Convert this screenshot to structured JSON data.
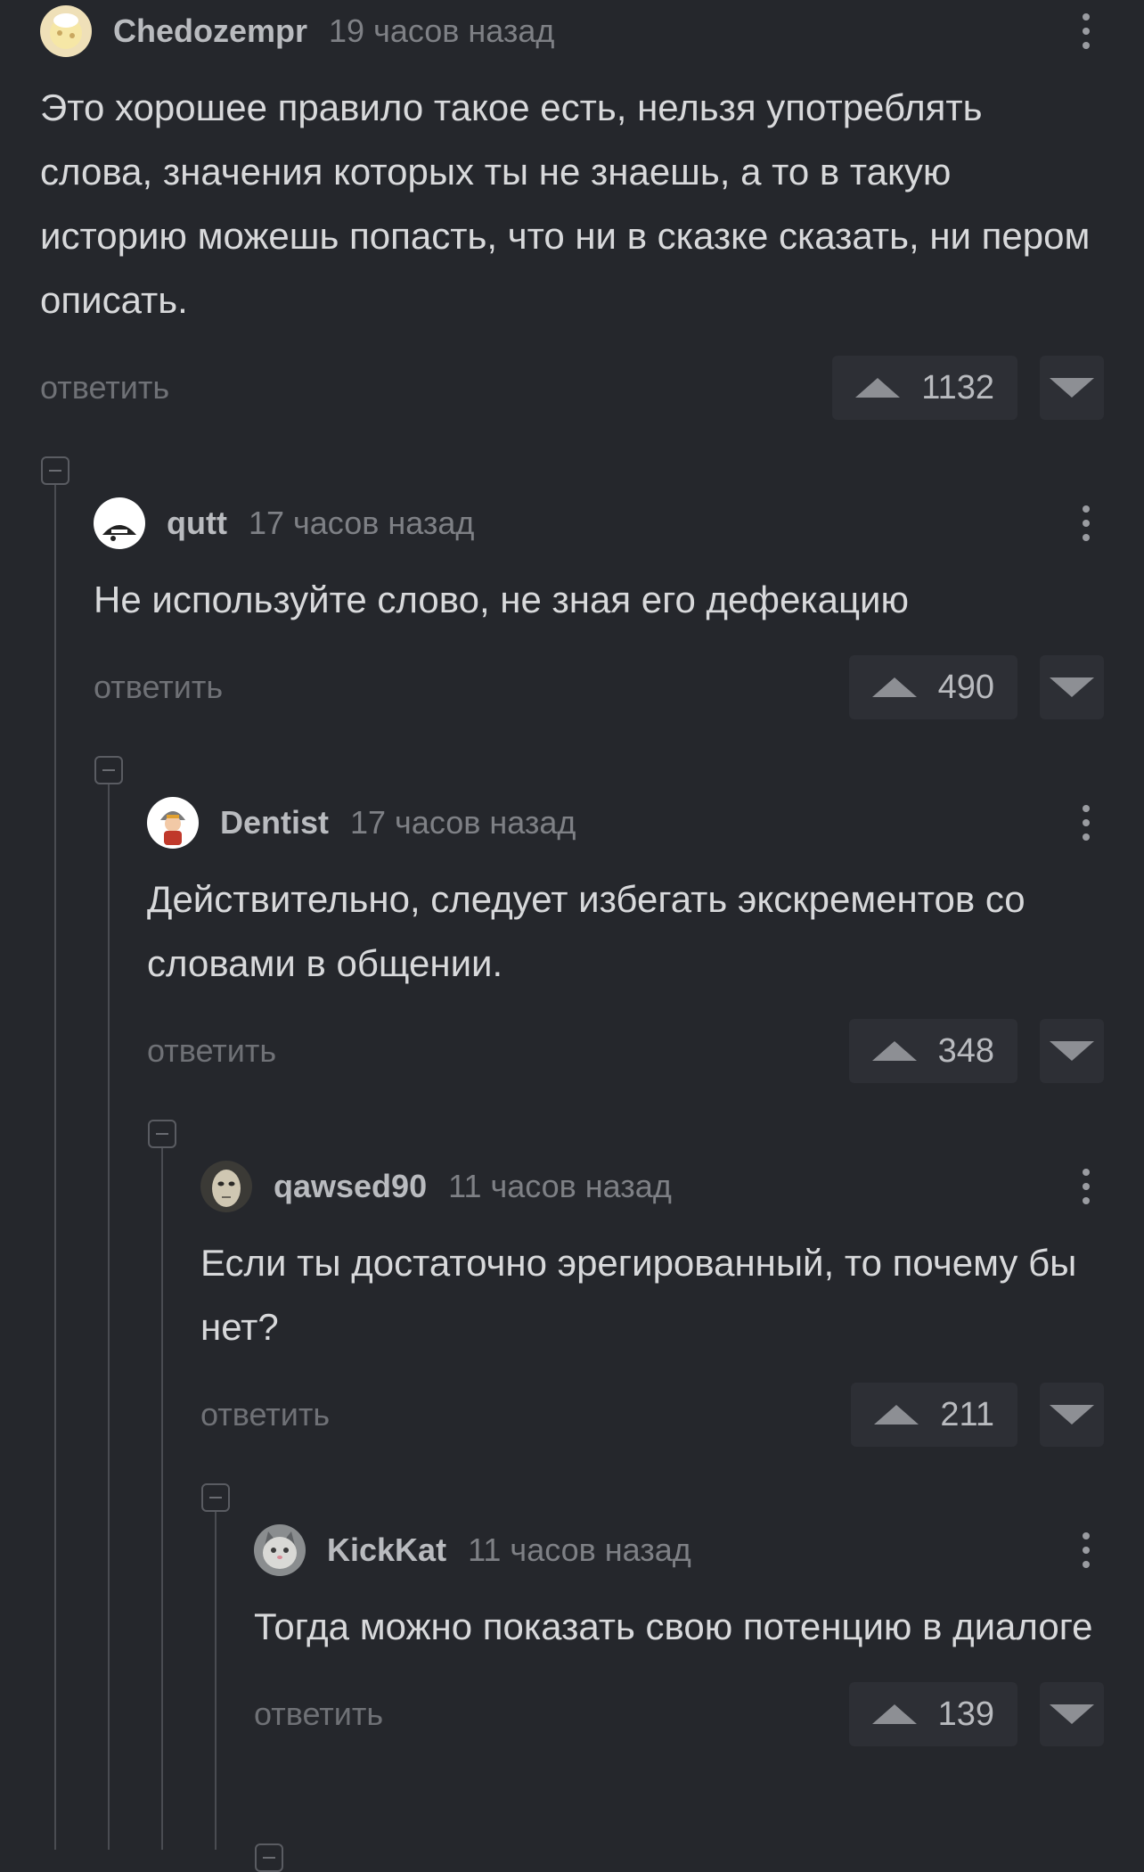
{
  "comments": [
    {
      "username": "Chedozempr",
      "time": "19 часов назад",
      "text": "Это хорошее правило такое есть, нельзя употреблять слова, значения которых ты не знаешь, а то в такую историю можешь попасть, что ни в сказке сказать, ни пером описать.",
      "reply_label": "ответить",
      "score": "1132"
    },
    {
      "username": "qutt",
      "time": "17 часов назад",
      "text": "Не используйте слово, не зная его дефекацию",
      "reply_label": "ответить",
      "score": "490"
    },
    {
      "username": "Dentist",
      "time": "17 часов назад",
      "text": "Действительно, следует избегать экскрементов со словами в общении.",
      "reply_label": "ответить",
      "score": "348"
    },
    {
      "username": "qawsed90",
      "time": "11 часов назад",
      "text": "Если ты достаточно эрегированный, то почему бы нет?",
      "reply_label": "ответить",
      "score": "211"
    },
    {
      "username": "KickKat",
      "time": "11 часов назад",
      "text": "Тогда можно показать свою потенцию в диалоге",
      "reply_label": "ответить",
      "score": "139"
    }
  ],
  "theme": {
    "background": "#25272c",
    "text": "#d8d9db",
    "muted": "#7e8085",
    "vote_bg": "#2d2f35"
  }
}
